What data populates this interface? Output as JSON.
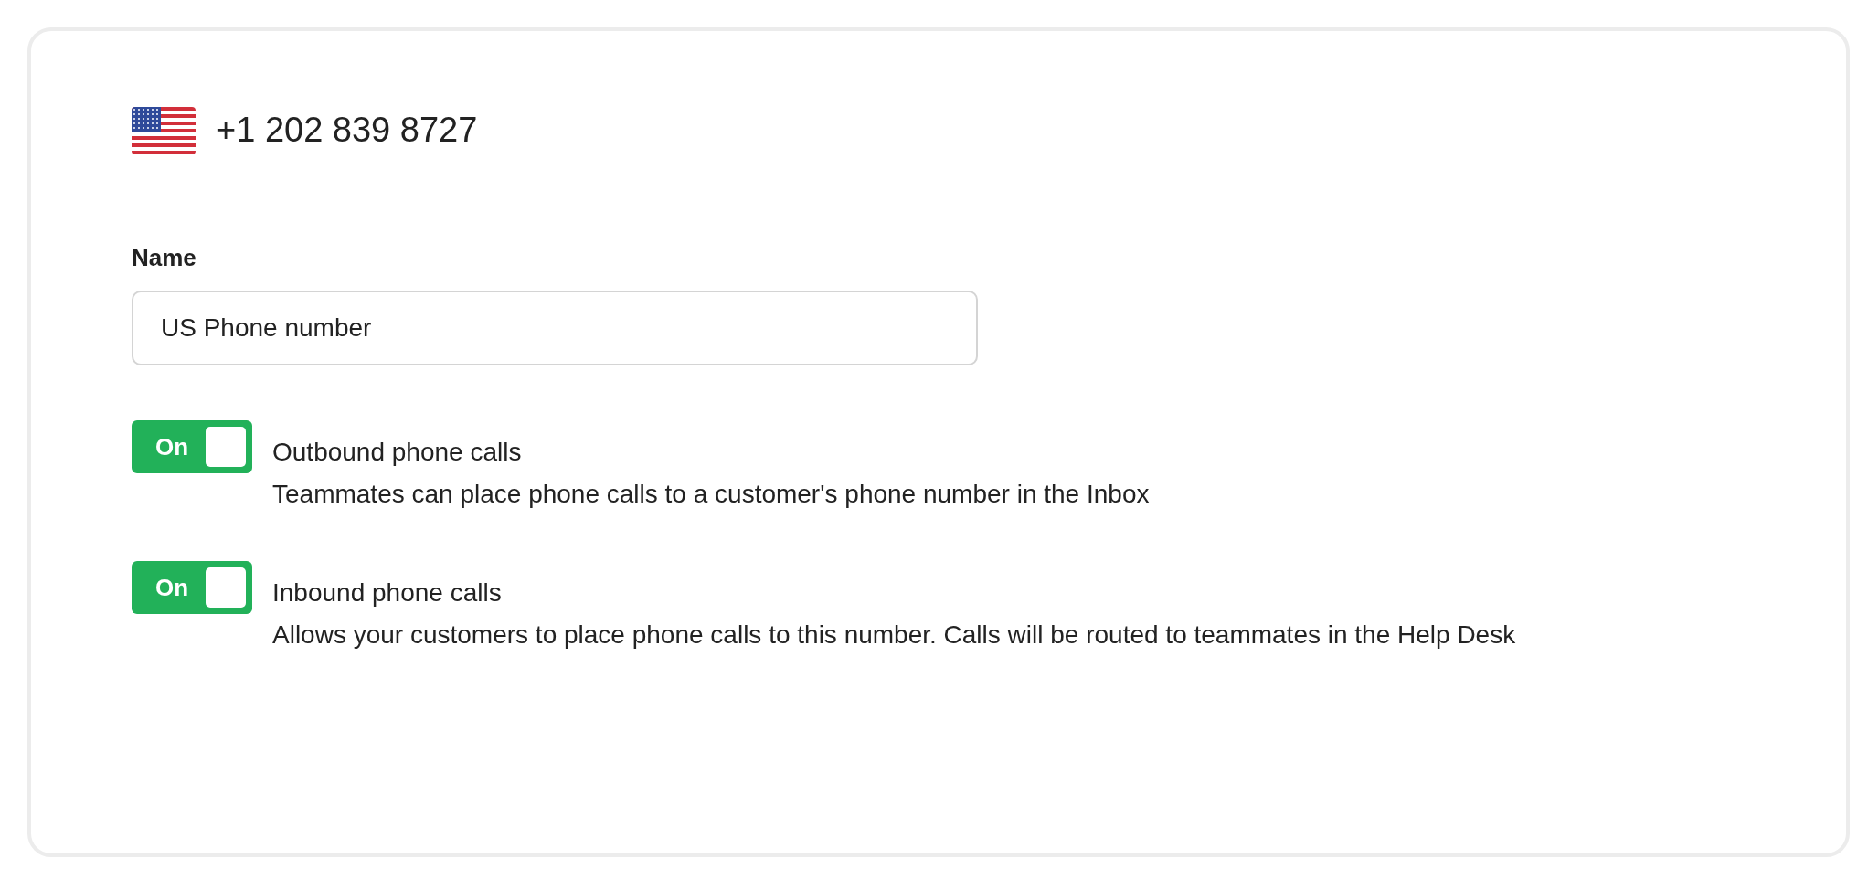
{
  "phone_number": "+1 202 839 8727",
  "name_field": {
    "label": "Name",
    "value": "US Phone number"
  },
  "settings": [
    {
      "toggle_label": "On",
      "on": true,
      "title": "Outbound phone calls",
      "description": "Teammates can place phone calls to a customer's phone number in the Inbox"
    },
    {
      "toggle_label": "On",
      "on": true,
      "title": "Inbound phone calls",
      "description": "Allows your customers to place phone calls to this number. Calls will be routed to teammates in the Help Desk"
    }
  ]
}
